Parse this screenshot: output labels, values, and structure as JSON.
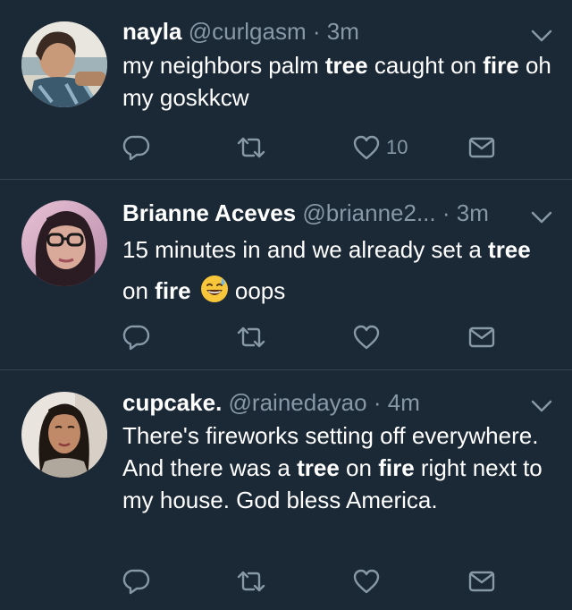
{
  "tweets": [
    {
      "name": "nayla",
      "handle": "@curlgasm",
      "separator": "·",
      "time": "3m",
      "text": [
        "my neighbors palm ",
        "tree",
        " caught on ",
        "fire",
        " oh my goskkcw"
      ],
      "likes": "10",
      "icons": [
        "reply-icon",
        "retweet-icon",
        "like-icon",
        "message-icon"
      ]
    },
    {
      "name": "Brianne Aceves",
      "handle": "@brianne2...",
      "separator": "·",
      "time": "3m",
      "text": [
        "15 minutes in and we already set a ",
        "tree",
        " on ",
        "fire",
        "oops"
      ],
      "emoji": "sweat-smile-emoji",
      "likes": "",
      "icons": [
        "reply-icon",
        "retweet-icon",
        "like-icon",
        "message-icon"
      ]
    },
    {
      "name": "cupcake.",
      "handle": "@rainedayao",
      "separator": "·",
      "time": "4m",
      "text": [
        "There's fireworks setting off everywhere. And there was a ",
        "tree",
        " on ",
        "fire",
        " right next to my house. God bless America."
      ],
      "likes": "",
      "icons": [
        "reply-icon",
        "retweet-icon",
        "like-icon",
        "message-icon"
      ]
    }
  ],
  "colors": {
    "background": "#1b2836",
    "divider": "#38444d",
    "text": "#ffffff",
    "secondary": "#8899a6"
  }
}
